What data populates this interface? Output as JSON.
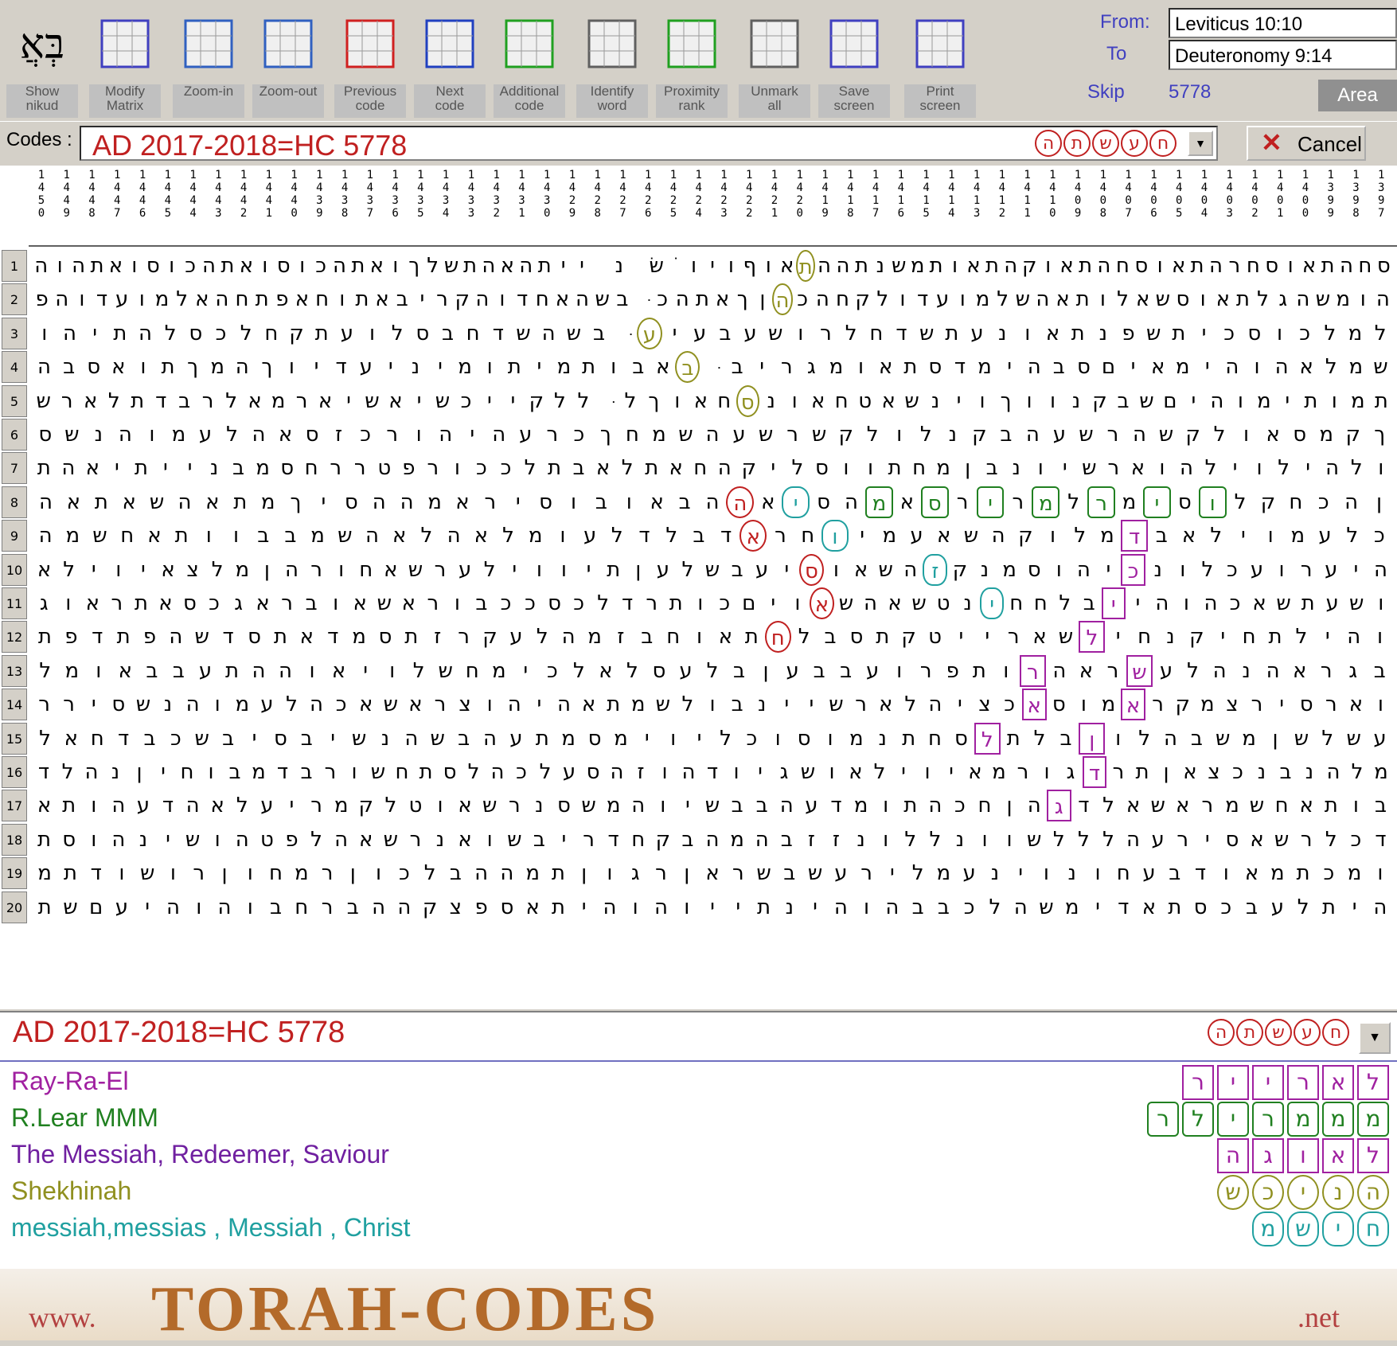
{
  "toolbar": {
    "buttons": [
      {
        "label": "Show\nnikud",
        "icon": "nikud-icon"
      },
      {
        "label": "Modify\nMatrix",
        "icon": "matrix-icon"
      },
      {
        "label": "Zoom-in",
        "icon": "zoom-in-icon"
      },
      {
        "label": "Zoom-out",
        "icon": "zoom-out-icon"
      },
      {
        "label": "Previous\ncode",
        "icon": "previous-icon"
      },
      {
        "label": "Next\ncode",
        "icon": "next-icon"
      },
      {
        "label": "Additional\ncode",
        "icon": "additional-icon"
      },
      {
        "label": "Identify\nword",
        "icon": "identify-icon"
      },
      {
        "label": "Proximity\nrank",
        "icon": "proximity-icon"
      },
      {
        "label": "Unmark\nall",
        "icon": "unmark-icon"
      },
      {
        "label": "Save\nscreen",
        "icon": "save-icon"
      },
      {
        "label": "Print\nscreen",
        "icon": "print-icon"
      }
    ],
    "nikud_glyph": "בְּאֲ",
    "from_label": "From:",
    "from_value": "Leviticus 10:10",
    "to_label": "To",
    "to_value": "Deuteronomy 9:14",
    "skip_label": "Skip",
    "skip_value": "5778",
    "area_label": "Area"
  },
  "codes": {
    "label": "Codes :",
    "value": "AD 2017-2018=HC 5778",
    "hebrew_letters": [
      "ה",
      "ת",
      "ש",
      "ע",
      "ח"
    ],
    "cancel_label": "Cancel"
  },
  "columns": [
    "1450",
    "1449",
    "1448",
    "1447",
    "1446",
    "1445",
    "1444",
    "1443",
    "1442",
    "1441",
    "1440",
    "1439",
    "1438",
    "1437",
    "1436",
    "1435",
    "1434",
    "1433",
    "1432",
    "1431",
    "1430",
    "1429",
    "1428",
    "1427",
    "1426",
    "1425",
    "1424",
    "1423",
    "1422",
    "1421",
    "1420",
    "1419",
    "1418",
    "1417",
    "1416",
    "1415",
    "1414",
    "1413",
    "1412",
    "1411",
    "1410",
    "1409",
    "1408",
    "1407",
    "1406",
    "1405",
    "1404",
    "1403",
    "1402",
    "1401",
    "1400",
    "1399",
    "1398",
    "1397"
  ],
  "rows": [
    "סחהתאוסחרהתאוסחהתאוקהתאותמשנתההתאוףויוֹשׁנ ייתהאהתשלךואתהכוסואתהכוסואתהוה",
    "הומשהגלתאוסשאלותאהשלמועדולקחהכהןךאתהכּבשהאחדוהקריבאתוחאפתחהאלמועדוהפ",
    "למלכוסכיתשפנתאונעתשדחלרושעבעיעּבשהשדחבסלועתקחלכסלהתיהו",
    "שמלאהוהימאיםסבהימדסתאומגריבּבאבותמיתומיניעדיוךהמךתואסבה",
    "תמותימוהיםשבקנווךוינשאטחאונסחאוךלּללקייכשיאשיארמאלרבדתלארש",
    "ךקמסאולקשהרשעהבקנלולקשרשעהשמחךכרעהיהורכזסאהלעמוהנשס",
    "ולהילוילהוארשיונבןמחתווסליקהחאתלאבתלככורפטררחסמבנייתיאהת",
    "ןהכחקלוסימרלמרירסאמהסיאההבאובוסיראמההסיךמתאהשאתאה",
    "כלעמוילאבדמלוקהשאעמיוחראדבלדלעומלאהלאהשמבבוותאחשמה",
    "היערועכלונכיהוסמנקזהשאוסיעבשלעןתיווילערשאחורהןמלצאיוילא",
    "ושעתשאכהוהייבלחחינטשאהשאויםכותרדלכסככבוראשאובראגכסאתראוג",
    "והילתחיקנחילשארייטקתסבלחתאוחבזמהלעקרזתסמדאתסדשהפתדפת",
    "בגראהנהלעשראהרותפרועבבעןבלעסלאלכימחשלויאוההתעבבאומל",
    "וארסירצמקראמוסאכציהלארשיינבולשמתאהיהוצראשאכהלעמוהנשסירר",
    "עשלשןמשבהלוןבלתלסחתנמוסוכליוימסמתעהבשהנשיבסיבשכבדחאל",
    "מלהנבנכצאןתרדגורמאיוילאושגיודהוזהסעלכהלסתחשורבדמבוחיןנהלד",
    "בותאחשמראשאלדגהןחכהתומדעהבבשיוהמשסנרשאוטלקמריעלאהדעהותא",
    "דכלרשאסירעהלללשוונללונזזבהמהבקחדריבשואנרשאהלפטהושינהוסת",
    "ומכתמאודבעחונוינעמלירעשבשראןרגוןתמההבלכוןרמחוןרושודתמ",
    "היתלעבכסתאדימשהלכבבהוהינתייוהוהיתאספצקההברחבוהוהיעםשת"
  ],
  "legend": {
    "title": "AD 2017-2018=HC 5778",
    "hebrew_letters": [
      "ה",
      "ת",
      "ש",
      "ע",
      "ח"
    ],
    "entries": [
      {
        "name": "Ray-Ra-El",
        "color": "#a020a0",
        "letters": [
          "ר",
          "י",
          "י",
          "ר",
          "א",
          "ל"
        ],
        "mark": "m-purple"
      },
      {
        "name": "R.Lear MMM",
        "color": "#208020",
        "letters": [
          "ר",
          "ל",
          "י",
          "ר",
          "מ",
          "מ",
          "מ"
        ],
        "mark": "m-green"
      },
      {
        "name": "The Messiah, Redeemer, Saviour",
        "color": "#7020a0",
        "letters": [
          "ה",
          "ג",
          "ו",
          "א",
          "ל"
        ],
        "mark": "m-purple"
      },
      {
        "name": "Shekhinah",
        "color": "#909020",
        "letters": [
          "ש",
          "כ",
          "י",
          "נ",
          "ה"
        ],
        "mark": "m-olive"
      },
      {
        "name": "messiah,messias , Messiah , Christ",
        "color": "#20a0a0",
        "letters": [
          "מ",
          "ש",
          "י",
          "ח"
        ],
        "mark": "m-teal"
      }
    ]
  },
  "banner": {
    "www": "www.",
    "main": "TORAH-CODES",
    "net": ".net"
  }
}
